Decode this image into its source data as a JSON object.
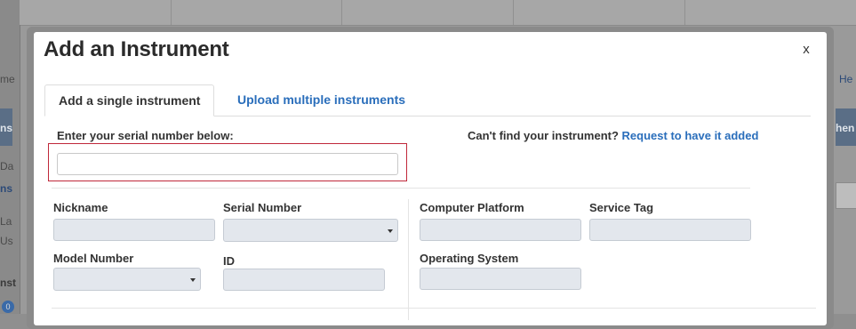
{
  "background": {
    "left_fragments": [
      "me",
      "ns",
      "Da",
      "ns",
      "La",
      "Us",
      "nst"
    ],
    "right_fragments": [
      "He",
      "hen"
    ],
    "badge": "0"
  },
  "modal": {
    "title": "Add an Instrument",
    "close_label": "x",
    "tabs": [
      {
        "label": "Add a single instrument",
        "active": true
      },
      {
        "label": "Upload multiple instruments",
        "active": false
      }
    ],
    "serial": {
      "label": "Enter your serial number below:",
      "value": "",
      "placeholder": ""
    },
    "cant_find": {
      "text": "Can't find your instrument?",
      "link": "Request to have it added"
    },
    "fields": {
      "nickname": {
        "label": "Nickname",
        "value": ""
      },
      "serial_number": {
        "label": "Serial Number",
        "value": ""
      },
      "computer_platform": {
        "label": "Computer Platform",
        "value": ""
      },
      "service_tag": {
        "label": "Service Tag",
        "value": ""
      },
      "model_number": {
        "label": "Model Number",
        "value": ""
      },
      "id": {
        "label": "ID",
        "value": ""
      },
      "operating_system": {
        "label": "Operating System",
        "value": ""
      }
    }
  },
  "colors": {
    "link": "#2a6ebb",
    "highlight_border": "#c0283a",
    "field_bg": "#e3e7ed",
    "overlay": "#9a9a9a"
  }
}
